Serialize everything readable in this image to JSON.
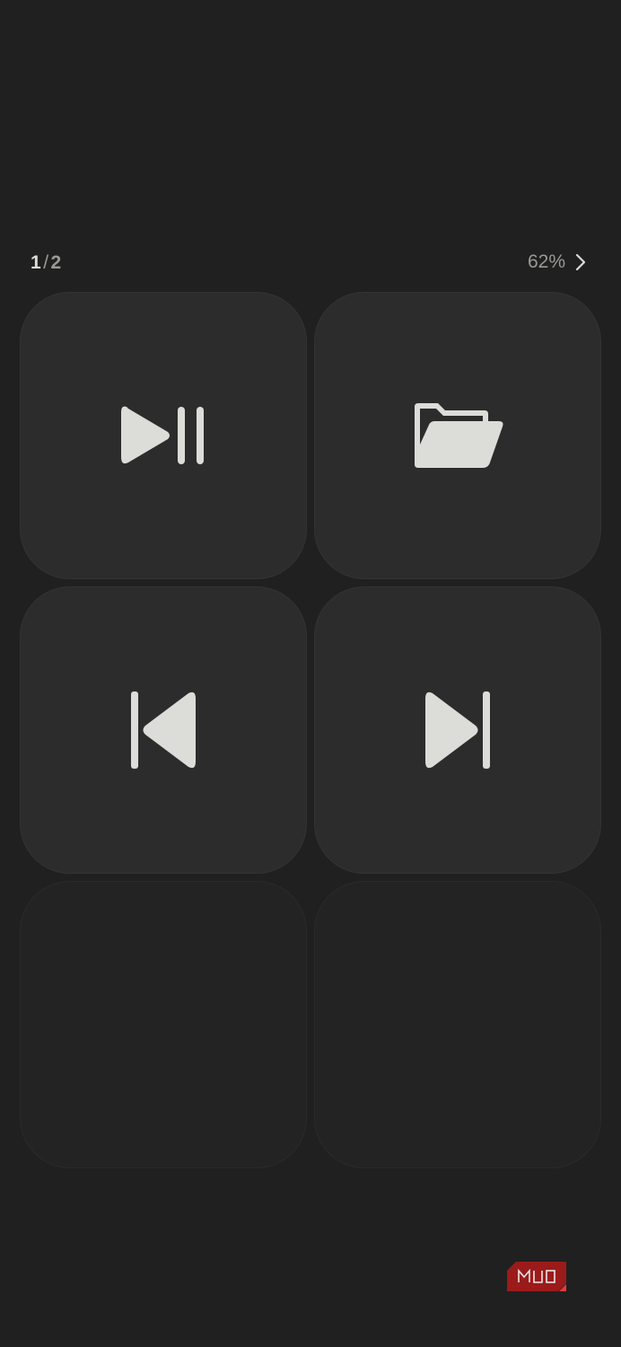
{
  "header": {
    "page_current": "1",
    "page_separator": "/",
    "page_total": "2",
    "zoom_label": "62%"
  },
  "tiles": [
    {
      "action": "play-pause",
      "icon": "play-pause-icon"
    },
    {
      "action": "open-folder",
      "icon": "folder-open-icon"
    },
    {
      "action": "previous-track",
      "icon": "skip-previous-icon"
    },
    {
      "action": "next-track",
      "icon": "skip-next-icon"
    },
    {
      "action": "",
      "icon": ""
    },
    {
      "action": "",
      "icon": ""
    }
  ],
  "watermark": {
    "text": "MUO"
  },
  "colors": {
    "background": "#202020",
    "tile": "#2c2c2c",
    "tile_empty": "#232323",
    "icon": "#dcdcd8",
    "muted_text": "#9a9a96",
    "brand_red": "#9b1b1b"
  }
}
